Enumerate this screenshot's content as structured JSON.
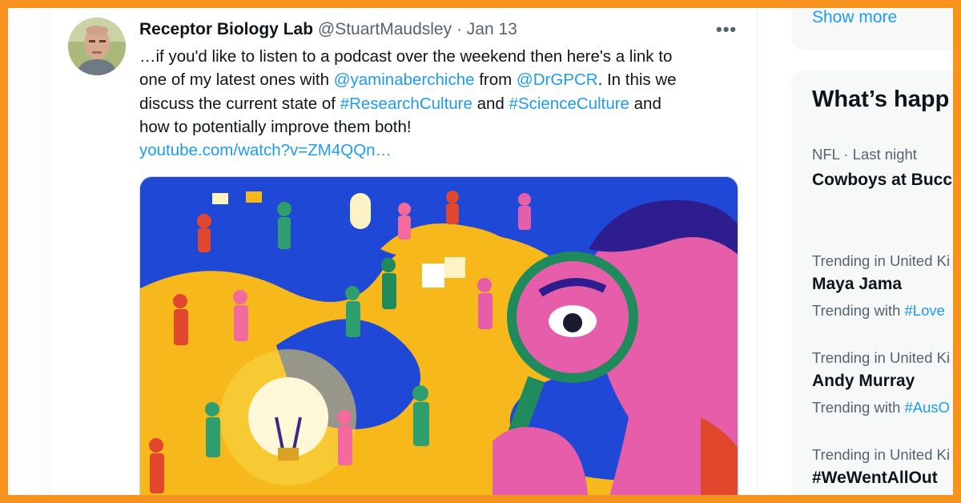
{
  "tweet": {
    "display_name": "Receptor Biology Lab",
    "handle": "@StuartMaudsley",
    "separator": "·",
    "date": "Jan 13",
    "more_label": "•••",
    "lines": [
      [
        {
          "t": "…if you'd like to listen to a podcast over the weekend then here's a link to",
          "link": false
        }
      ],
      [
        {
          "t": "one of my latest ones with ",
          "link": false
        },
        {
          "t": "@yaminaberchiche",
          "link": true
        },
        {
          "t": " from ",
          "link": false
        },
        {
          "t": "@DrGPCR",
          "link": true
        },
        {
          "t": ". In this we",
          "link": false
        }
      ],
      [
        {
          "t": "discuss the current state of ",
          "link": false
        },
        {
          "t": "#ResearchCulture",
          "link": true
        },
        {
          "t": " and ",
          "link": false
        },
        {
          "t": "#ScienceCulture",
          "link": true
        },
        {
          "t": " and",
          "link": false
        }
      ],
      [
        {
          "t": "how to potentially improve them both!",
          "link": false
        }
      ],
      [
        {
          "t": "youtube.com/watch?v=ZM4QQn…",
          "link": true
        }
      ]
    ]
  },
  "sidebar": {
    "show_more": "Show more",
    "whats_happening": "What’s happ",
    "trends": [
      {
        "meta": "NFL · Last night",
        "name": "Cowboys at Bucc",
        "sub_text": "",
        "sub_tag": ""
      },
      {
        "meta": "Trending in United Ki",
        "name": "Maya Jama",
        "sub_text": "Trending with ",
        "sub_tag": "#Love"
      },
      {
        "meta": "Trending in United Ki",
        "name": "Andy Murray",
        "sub_text": "Trending with ",
        "sub_tag": "#AusO"
      },
      {
        "meta": "Trending in United Ki",
        "name": "#WeWentAllOut",
        "sub_text": "",
        "sub_tag": ""
      }
    ]
  },
  "colors": {
    "frame": "#f7931e",
    "link": "#1d9bf0",
    "text": "#0f1419",
    "muted": "#536471",
    "media_bg": "#1f48d6"
  }
}
